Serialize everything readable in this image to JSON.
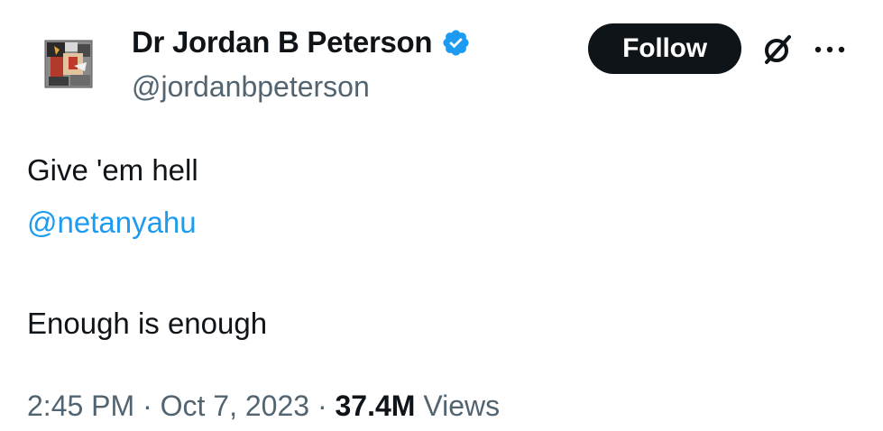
{
  "author": {
    "display_name": "Dr Jordan B Peterson",
    "handle": "@jordanbpeterson",
    "verified": true
  },
  "actions": {
    "follow_label": "Follow",
    "grok_icon": "grok-icon",
    "more_icon": "more-icon"
  },
  "tweet": {
    "line1": "Give 'em hell",
    "mention": "@netanyahu",
    "line3": "Enough is enough"
  },
  "meta": {
    "time": "2:45 PM",
    "separator": " · ",
    "date": "Oct 7, 2023",
    "views_count": "37.4M",
    "views_label": " Views"
  },
  "colors": {
    "text": "#0f1419",
    "secondary": "#536471",
    "link": "#1d9bf0",
    "verified": "#1d9bf0",
    "button_bg": "#0f1419"
  }
}
